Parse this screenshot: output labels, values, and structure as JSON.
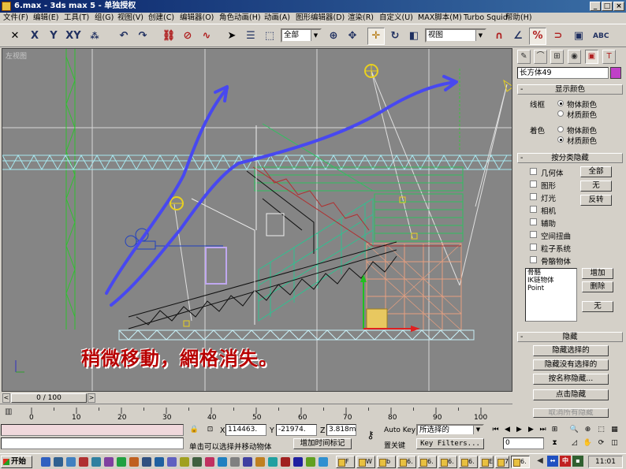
{
  "window": {
    "title": "6.max - 3ds max 5 - 单独授权",
    "min": "_",
    "max": "□",
    "close": "×"
  },
  "menu": [
    "文件(F)",
    "编辑(E)",
    "工具(T)",
    "组(G)",
    "视图(V)",
    "创建(C)",
    "编辑器(O)",
    "角色动画(H)",
    "动画(A)",
    "图形编辑器(D)",
    "渲染(R)",
    "自定义(U)",
    "MAX脚本(M)",
    "Turbo Squid",
    "帮助(H)"
  ],
  "toolbar": {
    "axis_x": "X",
    "axis_y": "Y",
    "axis_z": "Z",
    "axis_xy": "XY",
    "selection_filter": "全部",
    "reference_coord": "视图",
    "icons": [
      "undo-icon",
      "redo-icon",
      "link-icon",
      "unlink-icon",
      "bind-space-warp-icon",
      "select-icon",
      "select-by-name-icon",
      "region-select-icon",
      "select-move-icon",
      "select-rotate-icon",
      "select-scale-icon",
      "snap-icon",
      "angle-snap-icon",
      "percent-snap-icon",
      "spinner-snap-icon",
      "named-selection-icon",
      "mirror-icon",
      "align-icon"
    ]
  },
  "viewport": {
    "label": "左视图",
    "annotation": "稍微移動，網格消失。"
  },
  "command_panel": {
    "tabs": [
      "create-tab",
      "modify-tab",
      "hierarchy-tab",
      "motion-tab",
      "display-tab",
      "utilities-tab"
    ],
    "object_name": "长方体49",
    "object_color": "#c040c8",
    "display_color": {
      "title": "显示颜色",
      "wireframe_label": "线框",
      "shaded_label": "着色",
      "object_color": "物体颜色",
      "material_color": "材质颜色",
      "wireframe_selected": "object",
      "shaded_selected": "material"
    },
    "hide_by_category": {
      "title": "按分类隐藏",
      "items": [
        "几何体",
        "图形",
        "灯光",
        "相机",
        "辅助",
        "空间扭曲",
        "粒子系统",
        "骨骼物体"
      ],
      "btn_all": "全部",
      "btn_none": "无",
      "btn_invert": "反转",
      "list": [
        "骨骼",
        "IK链物体",
        "Point"
      ],
      "btn_add": "增加",
      "btn_remove": "删除",
      "btn_none2": "无"
    },
    "hide": {
      "title": "隐藏",
      "buttons": [
        "隐藏选择的",
        "隐藏没有选择的",
        "按名称隐藏...",
        "点击隐藏",
        "取消所有隐藏"
      ]
    }
  },
  "timeline": {
    "frame": "0 / 100",
    "ticks": [
      "0",
      "10",
      "20",
      "30",
      "40",
      "50",
      "60",
      "70",
      "80",
      "90",
      "100"
    ]
  },
  "status": {
    "x_label": "X",
    "x_value": "114463.",
    "y_label": "Y",
    "y_value": "-21974.",
    "z_label": "Z",
    "z_value": "3.818m",
    "prompt": "单击可以选择并移动物体",
    "add_time_tag": "增加时间标记",
    "auto_key": "Auto Key",
    "set_key": "置关键",
    "key_mode": "所选择的",
    "key_filters": "Key Filters...",
    "current_frame": "0"
  },
  "taskbar": {
    "start": "开始",
    "tasks": [
      "F",
      "W",
      "b",
      "6.",
      "6.",
      "6.",
      "6.",
      "E",
      "7",
      "6."
    ],
    "clock": "11:01",
    "tray": [
      "中"
    ]
  }
}
